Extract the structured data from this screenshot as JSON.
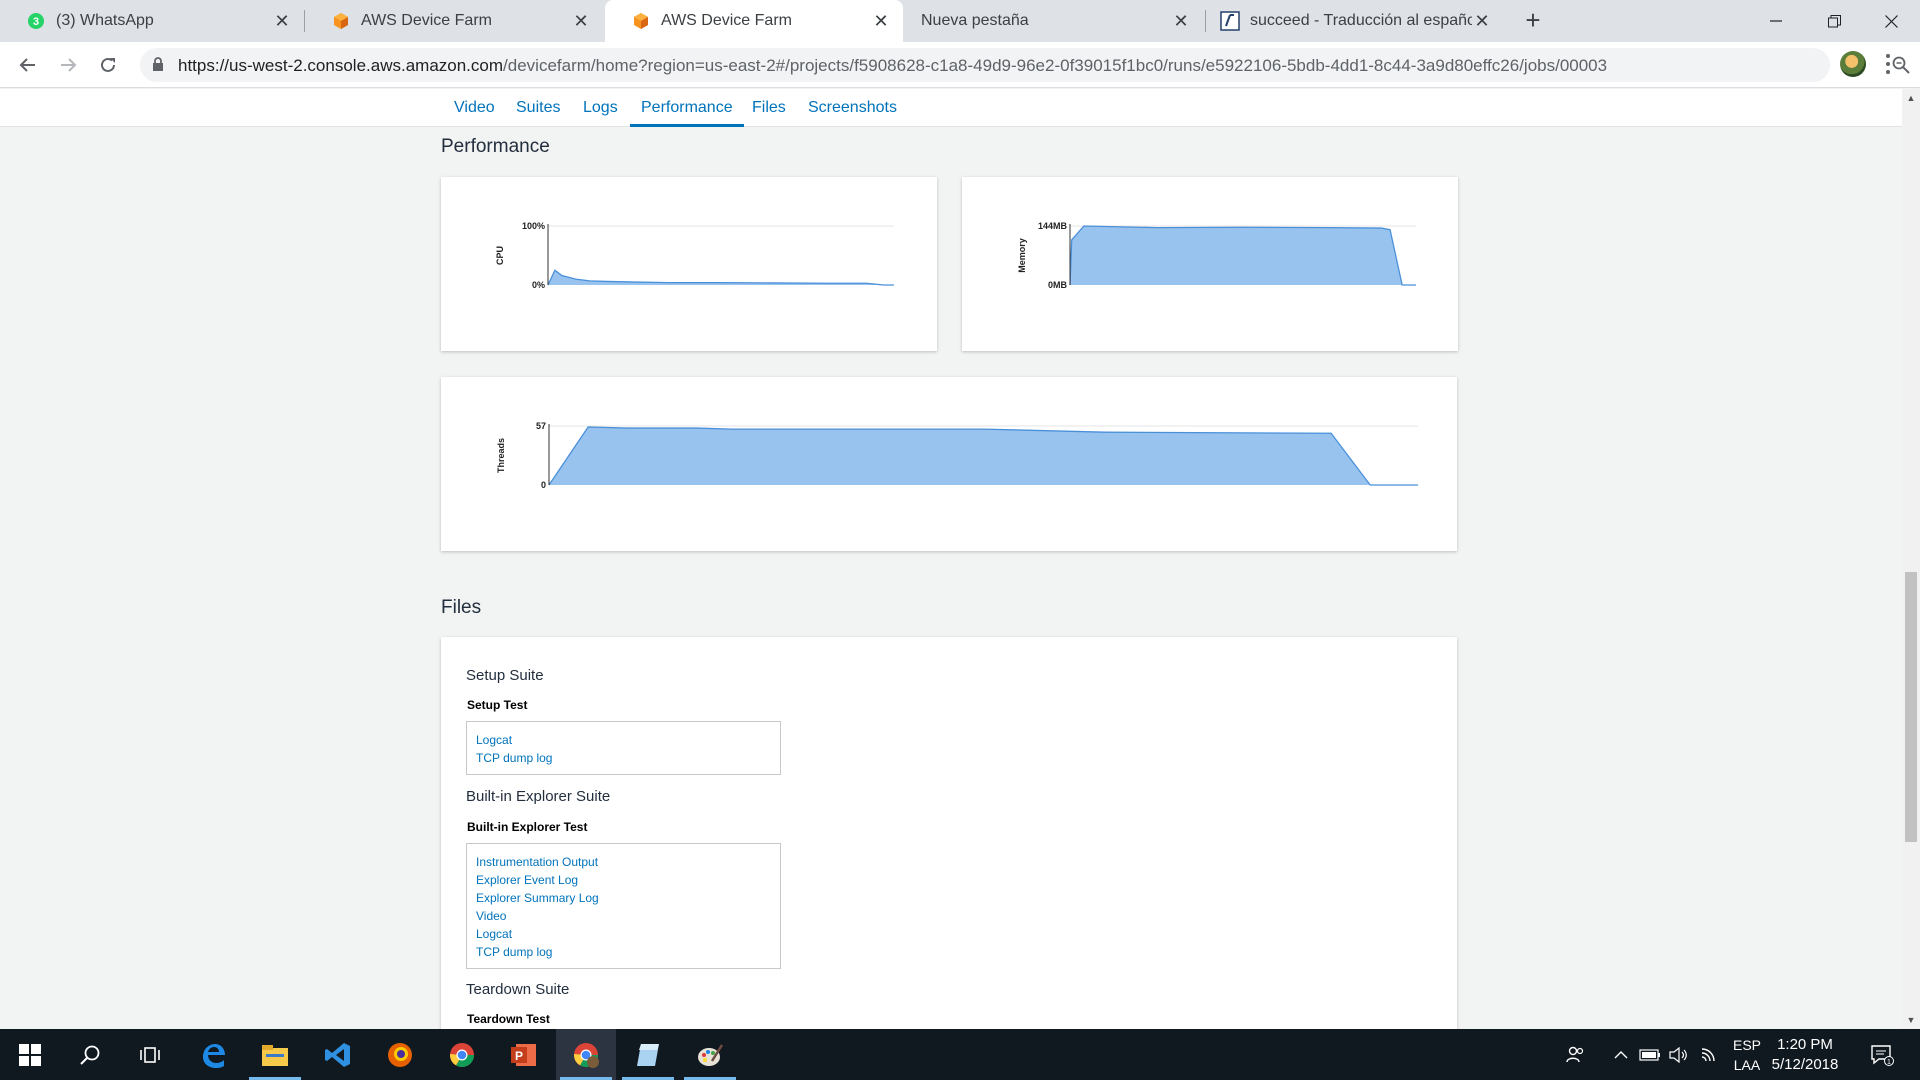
{
  "browser": {
    "tabs": [
      {
        "title": "(3) WhatsApp",
        "icon": "whatsapp-icon",
        "badge": "3",
        "active": false
      },
      {
        "title": "AWS Device Farm",
        "icon": "aws-cube-icon",
        "active": false
      },
      {
        "title": "AWS Device Farm",
        "icon": "aws-cube-icon",
        "active": true
      },
      {
        "title": "Nueva pestaña",
        "icon": "",
        "active": false
      },
      {
        "title": "succeed - Traducción al español",
        "icon": "linguee-icon",
        "active": false
      }
    ],
    "url_domain": "https://us-west-2.console.aws.amazon.com",
    "url_rest": "/devicefarm/home?region=us-east-2#/projects/f5908628-c1a8-49d9-96e2-0f39015f1bc0/runs/e5922106-5bdb-4dd1-8c44-3a9d80effc26/jobs/00003"
  },
  "subnav": {
    "tabs": [
      "Video",
      "Suites",
      "Logs",
      "Performance",
      "Files",
      "Screenshots"
    ],
    "active": "Performance"
  },
  "performance": {
    "title": "Performance"
  },
  "chart_data": [
    {
      "type": "area",
      "ylabel": "CPU",
      "yticks": [
        "100%",
        "0%"
      ],
      "ylim": [
        0,
        100
      ],
      "x": [
        0,
        2,
        4,
        8,
        12,
        17,
        25,
        35,
        50,
        65,
        80,
        92,
        97,
        100
      ],
      "values": [
        0,
        25,
        16,
        10,
        7,
        6,
        5,
        4,
        4,
        3.5,
        3,
        3,
        0,
        0
      ],
      "color": "#99c3ef",
      "line_color": "#4a90d9"
    },
    {
      "type": "area",
      "ylabel": "Memory",
      "yticks": [
        "144MB",
        "0MB"
      ],
      "ylim": [
        0,
        144
      ],
      "x": [
        0,
        0.5,
        4,
        25,
        50,
        75,
        90,
        92.5,
        96,
        100
      ],
      "values": [
        0,
        110,
        144,
        140,
        141,
        140,
        139,
        135,
        0,
        0
      ],
      "color": "#99c3ef",
      "line_color": "#4a90d9"
    },
    {
      "type": "area",
      "ylabel": "Threads",
      "yticks": [
        "57",
        "0"
      ],
      "ylim": [
        0,
        57
      ],
      "x": [
        0,
        4.5,
        9,
        17,
        21,
        50,
        64,
        90,
        94.5,
        100
      ],
      "values": [
        0,
        56,
        55,
        55,
        54,
        54,
        51,
        50,
        0,
        0
      ],
      "color": "#99c3ef",
      "line_color": "#4a90d9"
    }
  ],
  "files": {
    "title": "Files",
    "suites": [
      {
        "name": "Setup Suite",
        "test": "Setup Test",
        "files": [
          "Logcat",
          "TCP dump log"
        ]
      },
      {
        "name": "Built-in Explorer Suite",
        "test": "Built-in Explorer Test",
        "files": [
          "Instrumentation Output",
          "Explorer Event Log",
          "Explorer Summary Log",
          "Video",
          "Logcat",
          "TCP dump log"
        ]
      },
      {
        "name": "Teardown Suite",
        "test": "Teardown Test",
        "files": []
      }
    ]
  },
  "taskbar": {
    "apps": [
      "windows-start-icon",
      "search-icon",
      "task-view-icon",
      "edge-icon",
      "file-explorer-icon",
      "vscode-icon",
      "firefox-icon",
      "chrome-icon",
      "powerpoint-icon",
      "chrome-alt-icon",
      "notes-app-icon",
      "paint-icon"
    ],
    "lang": "ESP",
    "lang_sub": "LAA",
    "time": "1:20 PM",
    "date": "5/12/2018",
    "notification_count": "1"
  }
}
